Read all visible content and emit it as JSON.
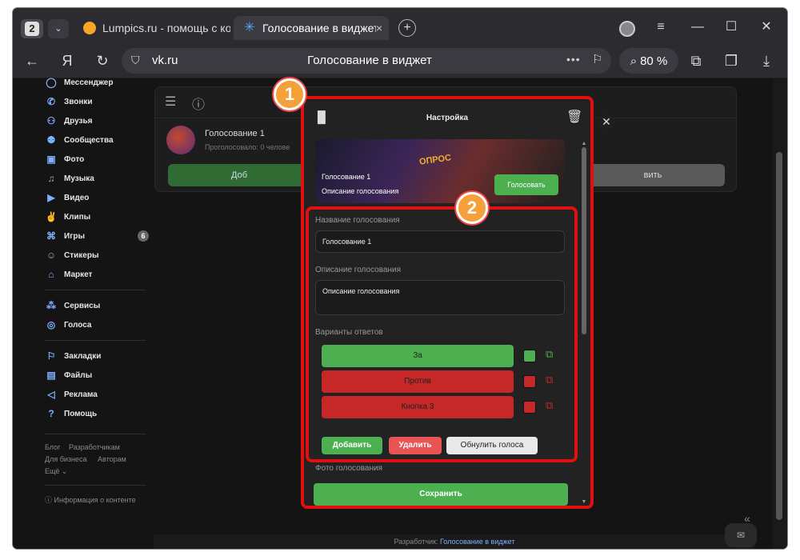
{
  "browser": {
    "tab_count": "2",
    "tabs": [
      {
        "title": "Lumpics.ru - помощь с ко"
      },
      {
        "title": "Голосование в виджет",
        "close": "×"
      }
    ],
    "new_tab": "+",
    "window_controls": {
      "menu": "≡",
      "minimize": "—",
      "maximize": "☐",
      "close": "✕"
    },
    "url": "vk.ru",
    "page_title": "Голосование в виджет",
    "zoom": "80 %"
  },
  "sidebar": {
    "items": [
      {
        "label": "Мессенджер",
        "icon": "chat-icon"
      },
      {
        "label": "Звонки",
        "icon": "phone-icon"
      },
      {
        "label": "Друзья",
        "icon": "friends-icon"
      },
      {
        "label": "Сообщества",
        "icon": "groups-icon"
      },
      {
        "label": "Фото",
        "icon": "photo-icon"
      },
      {
        "label": "Музыка",
        "icon": "music-icon"
      },
      {
        "label": "Видео",
        "icon": "video-icon"
      },
      {
        "label": "Клипы",
        "icon": "clips-icon"
      },
      {
        "label": "Игры",
        "icon": "games-icon",
        "badge": "6"
      },
      {
        "label": "Стикеры",
        "icon": "stickers-icon"
      },
      {
        "label": "Маркет",
        "icon": "market-icon"
      },
      {
        "label": "Сервисы",
        "icon": "services-icon"
      },
      {
        "label": "Голоса",
        "icon": "votes-icon"
      },
      {
        "label": "Закладки",
        "icon": "bookmarks-icon"
      },
      {
        "label": "Файлы",
        "icon": "files-icon"
      },
      {
        "label": "Реклама",
        "icon": "ads-icon"
      },
      {
        "label": "Помощь",
        "icon": "help-icon"
      }
    ],
    "footer": {
      "blog": "Блог",
      "developers": "Разработчикам",
      "business": "Для бизнеса",
      "authors": "Авторам",
      "more": "Ещё ⌄",
      "info": "ⓘ Информация о контенте"
    }
  },
  "content": {
    "poll_name": "Голосование 1",
    "poll_sub": "Проголосовало: 0 челове",
    "add_button": "Доб",
    "other_button": "вить",
    "developer_prefix": "Разработчик:",
    "developer_link": "Голосование в виджет"
  },
  "modal": {
    "title": "Настройка",
    "preview": {
      "banner": "ОПРОС",
      "title": "Голосование 1",
      "description": "Описание голосования",
      "vote_button": "Голосовать"
    },
    "name_label": "Название голосования",
    "name_value": "Голосование 1",
    "desc_label": "Описание голосования",
    "desc_value": "Описание голосования",
    "options_label": "Варианты ответов",
    "options": [
      {
        "label": "За",
        "color": "#4caf50"
      },
      {
        "label": "Против",
        "color": "#c62828"
      },
      {
        "label": "Кнопка 3",
        "color": "#c62828"
      }
    ],
    "add_button": "Добавить",
    "delete_button": "Удалить",
    "reset_button": "Обнулить голоса",
    "photo_label": "Фото голосования",
    "save_button": "Сохранить"
  },
  "annotations": {
    "one": "1",
    "two": "2"
  },
  "colors": {
    "highlight": "#e01010",
    "marker": "#f6a03a",
    "accent_green": "#4caf50"
  }
}
